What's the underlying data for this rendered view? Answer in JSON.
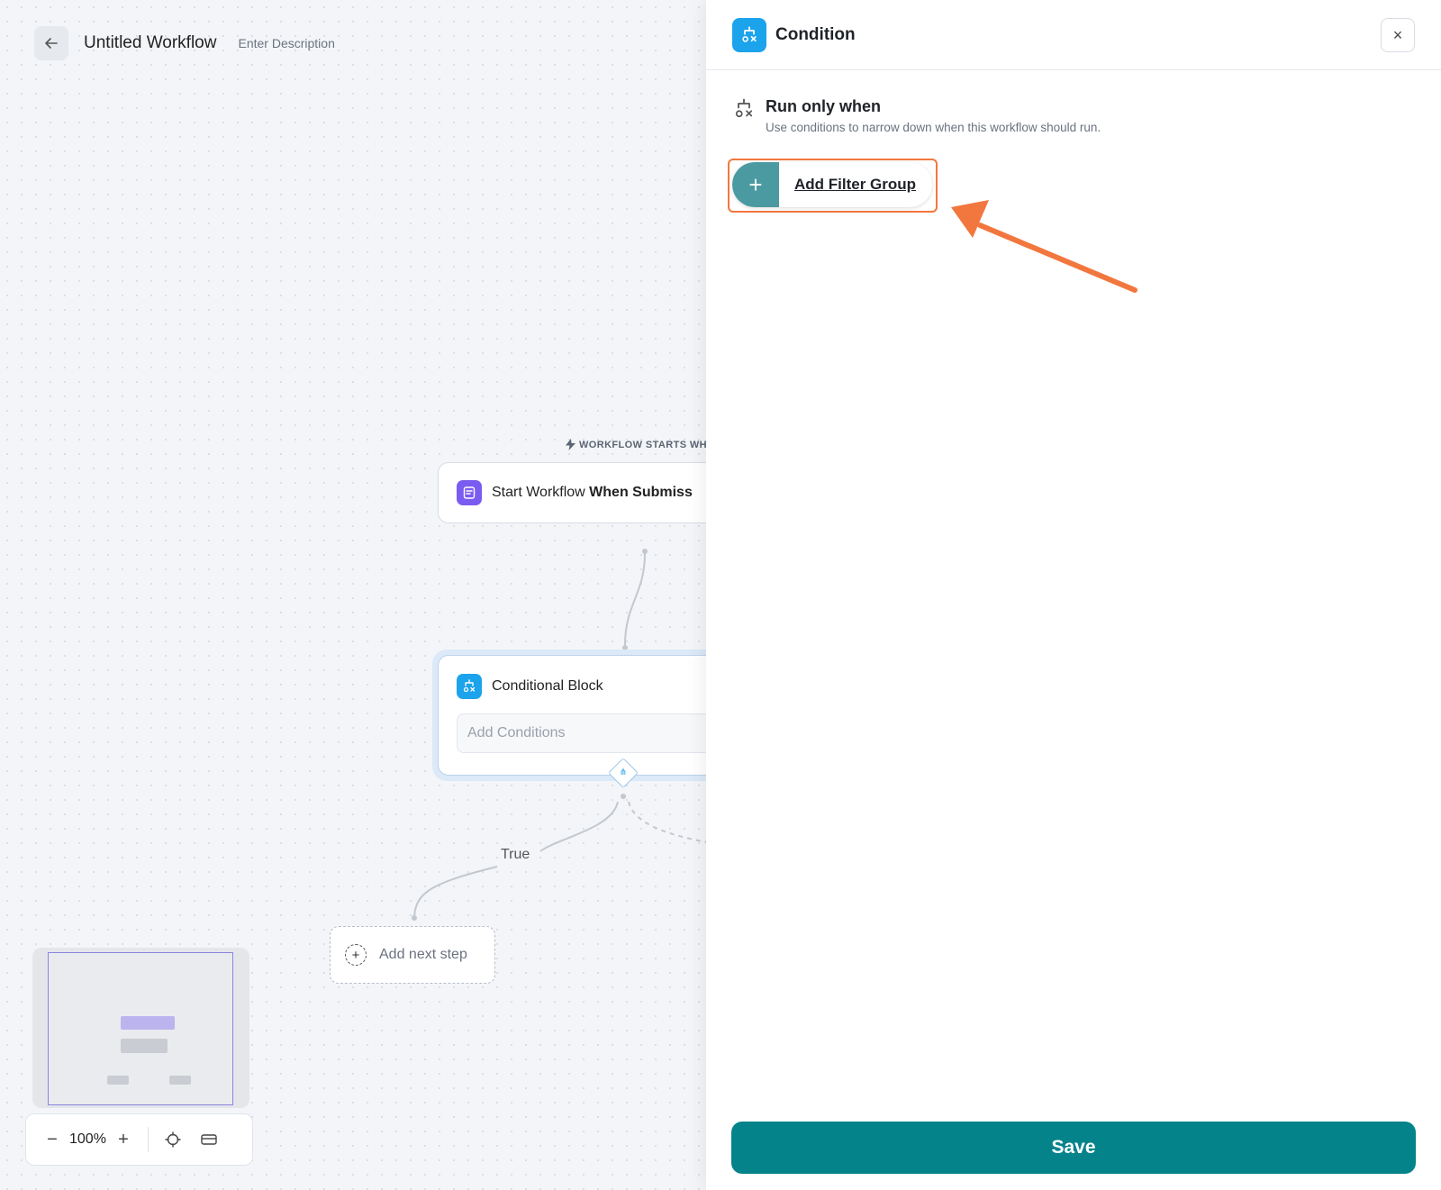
{
  "header": {
    "title": "Untitled Workflow",
    "description_placeholder": "Enter Description"
  },
  "canvas": {
    "trigger_label": "WORKFLOW STARTS WH",
    "start_node": {
      "text": "Start Workflow ",
      "bold": "When Submiss"
    },
    "conditional_node": {
      "title": "Conditional Block",
      "add_conditions": "Add Conditions"
    },
    "branch_label": "True",
    "next_step": "Add next step"
  },
  "zoom": {
    "minus": "−",
    "value": "100%",
    "plus": "+"
  },
  "panel": {
    "title": "Condition",
    "close": "×",
    "run_when_title": "Run only when",
    "run_when_subtitle": "Use conditions to narrow down when this workflow should run.",
    "add_filter_group": "Add Filter Group",
    "save": "Save"
  },
  "colors": {
    "accent_teal": "#05838a",
    "condition_blue": "#1ba3ec",
    "highlight_orange": "#f2773e",
    "form_purple": "#7b5cf0"
  }
}
